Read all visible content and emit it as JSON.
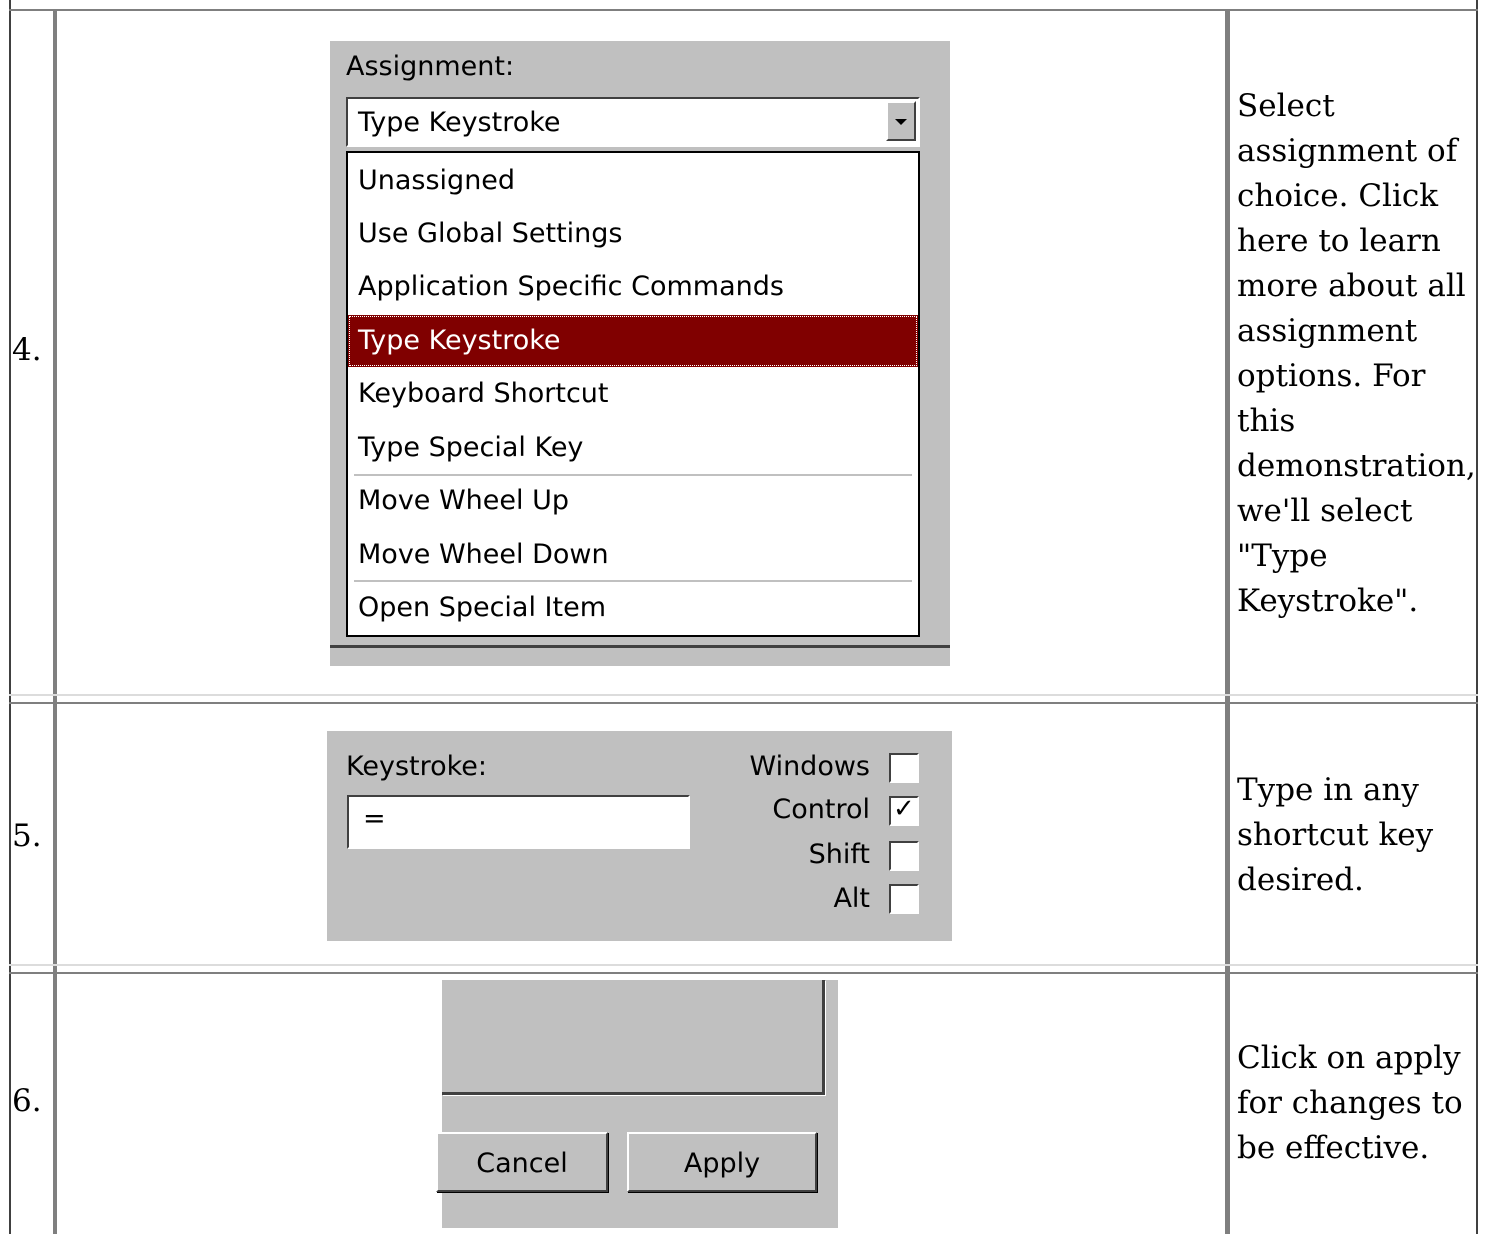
{
  "rows": [
    {
      "step": "4.",
      "description": "Select assignment of choice.  Click here to learn more about all assignment options.  For this demonstration, we'll select \"Type Keystroke\".",
      "assignment_label": "Assignment:",
      "combo_value": "Type Keystroke",
      "options": [
        "Unassigned",
        "Use Global Settings",
        "Application Specific Commands",
        "Type Keystroke",
        "Keyboard Shortcut",
        "Type Special Key",
        "Move Wheel Up",
        "Move Wheel Down",
        "Open Special Item"
      ],
      "selected_option": "Type Keystroke"
    },
    {
      "step": "5.",
      "description": "Type in any shortcut key desired.",
      "keystroke_label": "Keystroke:",
      "keystroke_value": "=",
      "modifiers": [
        {
          "label": "Windows",
          "checked": false
        },
        {
          "label": "Control",
          "checked": true
        },
        {
          "label": "Shift",
          "checked": false
        },
        {
          "label": "Alt",
          "checked": false
        }
      ]
    },
    {
      "step": "6.",
      "description": "Click on apply for changes to be effective.",
      "cancel_label": "Cancel",
      "apply_label": "Apply"
    }
  ],
  "colors": {
    "dialog_bg": "#c0c0c0",
    "selection": "#800000",
    "grid": "#7f7f7f"
  }
}
